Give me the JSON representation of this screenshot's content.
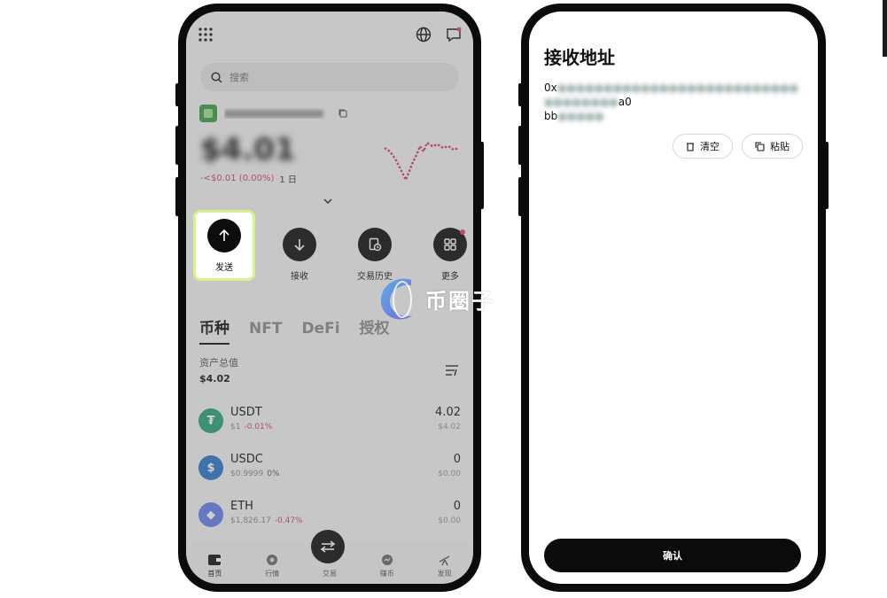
{
  "left_phone": {
    "search": {
      "placeholder": "搜索"
    },
    "balance": {
      "amount": "$4.01",
      "change": "-<$0.01 (0.00%)",
      "period": "1 日"
    },
    "actions": [
      {
        "label": "发送",
        "icon": "arrow-up-icon"
      },
      {
        "label": "接收",
        "icon": "arrow-down-icon"
      },
      {
        "label": "交易历史",
        "icon": "history-icon"
      },
      {
        "label": "更多",
        "icon": "grid-icon"
      }
    ],
    "tabs": [
      "币种",
      "NFT",
      "DeFi",
      "授权"
    ],
    "assets": {
      "title": "资产总值",
      "value": "$4.02"
    },
    "tokens": [
      {
        "name": "USDT",
        "price": "$1",
        "change": "-0.01%",
        "amount": "4.02",
        "usd": "$4.02",
        "color": "#26a17b",
        "symbol": "₮"
      },
      {
        "name": "USDC",
        "price": "$0.9999",
        "change": "0%",
        "amount": "0",
        "usd": "$0.00",
        "color": "#2775ca",
        "symbol": "$"
      },
      {
        "name": "ETH",
        "price": "$1,826.17",
        "change": "-0.47%",
        "amount": "0",
        "usd": "$0.00",
        "color": "#627eea",
        "symbol": "◆"
      }
    ],
    "tabbar": [
      "首页",
      "行情",
      "交易",
      "赚币",
      "发现"
    ]
  },
  "right_phone": {
    "title": "接收地址",
    "address_prefix": "0x",
    "address_suffix": "a0",
    "address_line2_prefix": "bb",
    "clear_label": "清空",
    "paste_label": "粘贴",
    "confirm_label": "确认"
  },
  "watermark": {
    "text": "币圈子"
  },
  "colors": {
    "highlight": "#d7f28b",
    "negative": "#d23c7a",
    "primary": "#0b0b0b"
  }
}
